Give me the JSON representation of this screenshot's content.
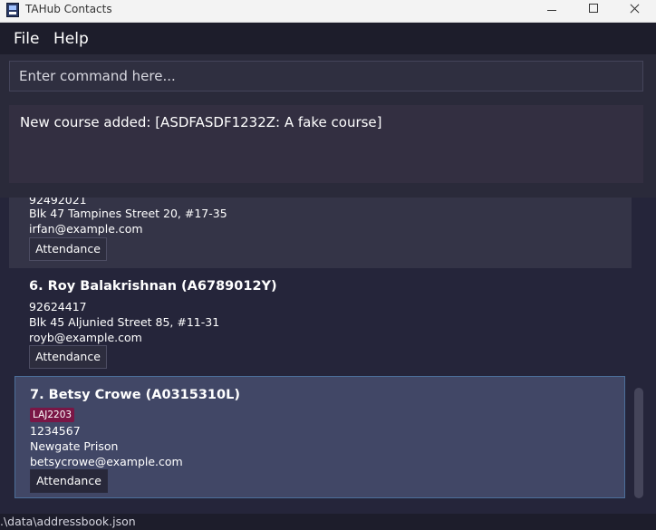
{
  "window": {
    "title": "TAHub Contacts"
  },
  "menu": {
    "file": "File",
    "help": "Help"
  },
  "command": {
    "placeholder": "Enter command here...",
    "value": ""
  },
  "result": {
    "text": "New course added: [ASDFASDF1232Z: A fake course]"
  },
  "contacts": [
    {
      "phone_cut": "92492021",
      "address": "Blk 47 Tampines Street 20, #17-35",
      "email": "irfan@example.com",
      "attendance_label": "Attendance"
    },
    {
      "name": "6.  Roy Balakrishnan  (A6789012Y)",
      "phone": "92624417",
      "address": "Blk 45 Aljunied Street 85, #11-31",
      "email": "royb@example.com",
      "attendance_label": "Attendance"
    },
    {
      "name": "7.  Betsy Crowe  (A0315310L)",
      "tag": "LAJ2203",
      "phone": "1234567",
      "address": "Newgate Prison",
      "email": "betsycrowe@example.com",
      "attendance_label": "Attendance"
    }
  ],
  "status": {
    "path": ".\\data\\addressbook.json"
  },
  "colors": {
    "background": "#1d1d2b",
    "selected_card": "#414766",
    "tag": "#7a1646"
  }
}
